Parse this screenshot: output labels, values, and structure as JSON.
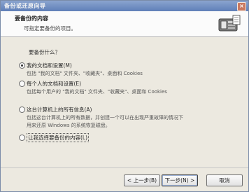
{
  "window": {
    "title": "备份或还原向导",
    "close_glyph": "×"
  },
  "header": {
    "heading": "要备份的内容",
    "subheading": "可指定要备份的项目。",
    "icon": "backup-wizard-icon"
  },
  "question": "要备份什么？",
  "options": [
    {
      "label": "我的文档和设置(M)",
      "desc_lines": [
        "包括 \"我的文档\" 文件夹、\"收藏夹\"、桌面和 Cookies"
      ],
      "checked": true
    },
    {
      "label": "每个人的文档和设置(E)",
      "desc_lines": [
        "包括每个用户的 \"我的文档\" 文件夹、\"收藏夹\"、桌面和 Cookies"
      ],
      "checked": false
    },
    {
      "label": "这台计算机上的所有信息(A)",
      "desc_lines": [
        "包括这台计算机上的所有数据，并创建一个可以在出现严重故障的情况下",
        "用来还原 Windows 的系统恢复磁盘。"
      ],
      "checked": false
    },
    {
      "label": "让我选择要备份的内容(L)",
      "desc_lines": [],
      "checked": false
    }
  ],
  "buttons": {
    "back": "< 上一步(B)",
    "next": "下一步(N) >",
    "cancel": "取消"
  },
  "colors": {
    "titlebar": "#6a88bf",
    "face": "#ece9e0",
    "header": "#fbfbfb"
  }
}
